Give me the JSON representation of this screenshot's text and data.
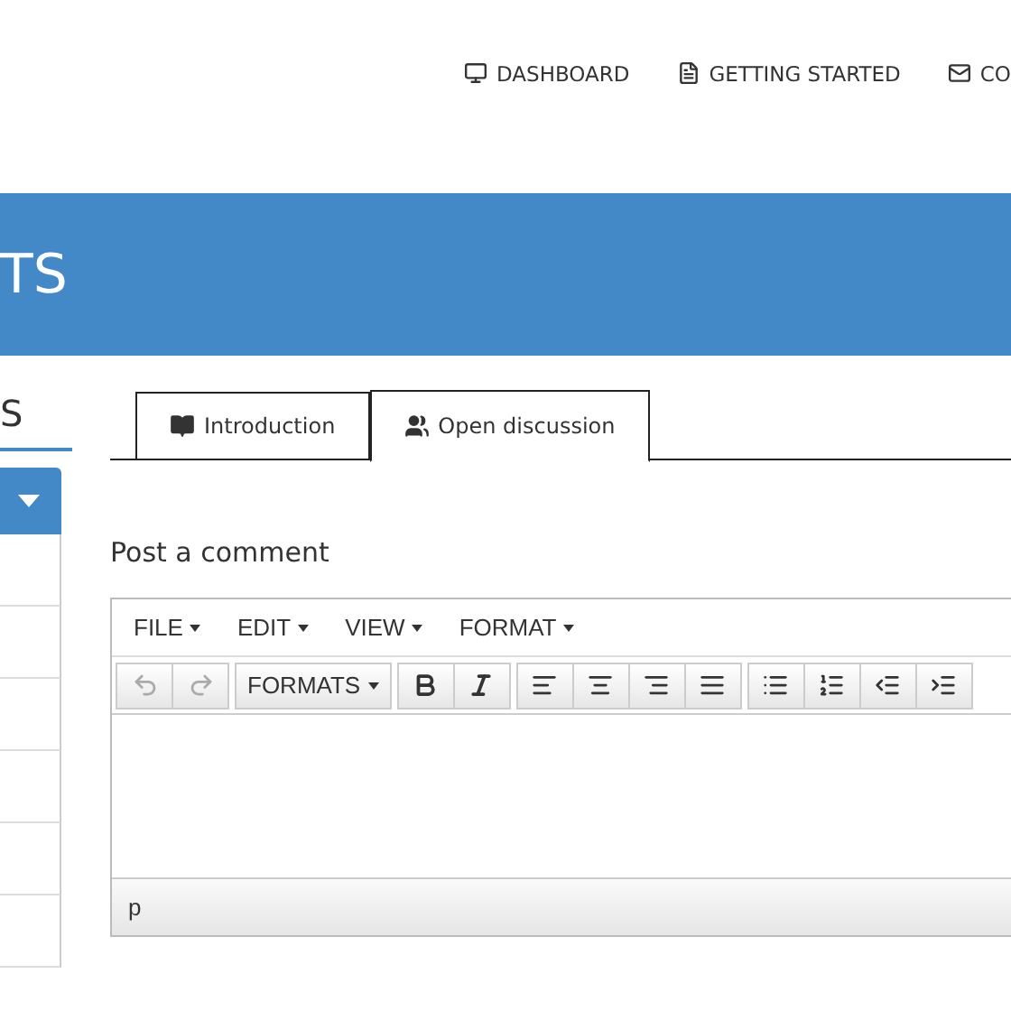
{
  "nav": [
    {
      "label": "DASHBOARD"
    },
    {
      "label": "GETTING STARTED"
    },
    {
      "label": "CO"
    }
  ],
  "banner": {
    "title": "TS"
  },
  "sidebar": {
    "heading": "S"
  },
  "tabs": [
    {
      "label": "Introduction",
      "selected": false
    },
    {
      "label": "Open discussion",
      "selected": true
    }
  ],
  "comment": {
    "title": "Post a comment",
    "menubar": [
      "FILE",
      "EDIT",
      "VIEW",
      "FORMAT"
    ],
    "toolbar": [
      {
        "kind": "undo",
        "disabled": true
      },
      {
        "kind": "redo",
        "disabled": true
      },
      {
        "kind": "sep"
      },
      {
        "kind": "menu",
        "label": "FORMATS"
      },
      {
        "kind": "sep"
      },
      {
        "kind": "bold",
        "disabled": false
      },
      {
        "kind": "italic",
        "disabled": false
      },
      {
        "kind": "sep"
      },
      {
        "kind": "alignleft",
        "disabled": false
      },
      {
        "kind": "aligncenter",
        "disabled": false
      },
      {
        "kind": "alignright",
        "disabled": false
      },
      {
        "kind": "justify",
        "disabled": false
      },
      {
        "kind": "sep"
      },
      {
        "kind": "bullets",
        "disabled": false
      },
      {
        "kind": "numbers",
        "disabled": false
      },
      {
        "kind": "outdent",
        "disabled": false
      },
      {
        "kind": "indent",
        "disabled": false
      }
    ],
    "path": "p"
  }
}
